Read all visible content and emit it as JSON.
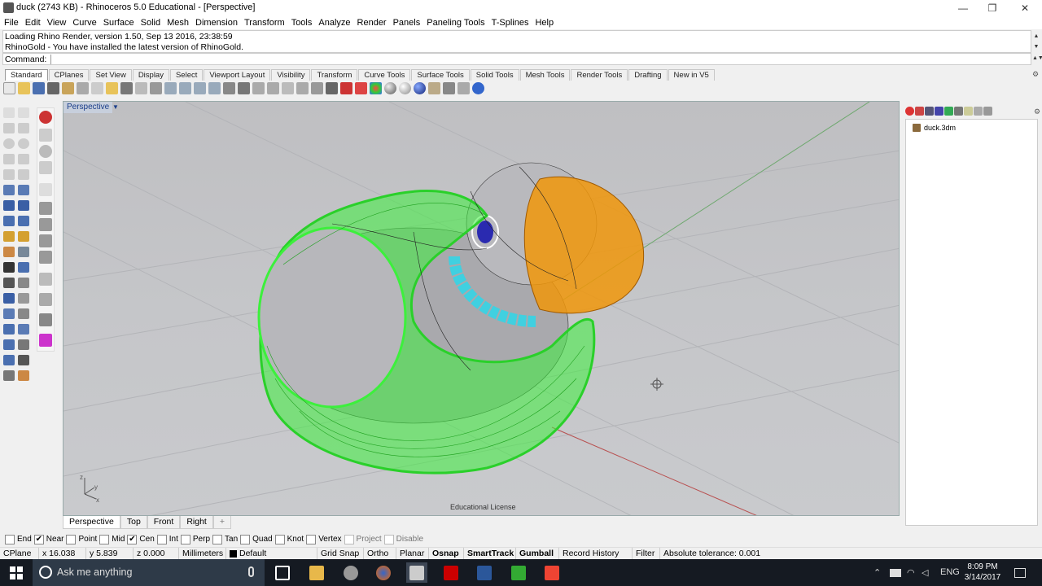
{
  "window": {
    "title": "duck (2743 KB) - Rhinoceros 5.0 Educational - [Perspective]",
    "minimize": "—",
    "maximize": "❐",
    "close": "✕"
  },
  "menu": [
    "File",
    "Edit",
    "View",
    "Curve",
    "Surface",
    "Solid",
    "Mesh",
    "Dimension",
    "Transform",
    "Tools",
    "Analyze",
    "Render",
    "Panels",
    "Paneling Tools",
    "T-Splines",
    "Help"
  ],
  "command_history": [
    "Loading Rhino Render, version 1.50, Sep 13 2016, 23:38:59",
    "RhinoGold - You have installed the latest version of RhinoGold."
  ],
  "command": {
    "label": "Command:",
    "value": ""
  },
  "toolbar_tabs": [
    "Standard",
    "CPlanes",
    "Set View",
    "Display",
    "Select",
    "Viewport Layout",
    "Visibility",
    "Transform",
    "Curve Tools",
    "Surface Tools",
    "Solid Tools",
    "Mesh Tools",
    "Render Tools",
    "Drafting",
    "New in V5"
  ],
  "viewport": {
    "name": "Perspective",
    "menu_arrow": "▼",
    "license": "Educational License",
    "axis_x": "x",
    "axis_y": "y",
    "axis_z": "z"
  },
  "viewport_tabs": [
    "Perspective",
    "Top",
    "Front",
    "Right",
    "+"
  ],
  "layers_panel": {
    "file": "duck.3dm"
  },
  "osnaps": [
    {
      "label": "End",
      "checked": false
    },
    {
      "label": "Near",
      "checked": true
    },
    {
      "label": "Point",
      "checked": false
    },
    {
      "label": "Mid",
      "checked": false
    },
    {
      "label": "Cen",
      "checked": true
    },
    {
      "label": "Int",
      "checked": false
    },
    {
      "label": "Perp",
      "checked": false
    },
    {
      "label": "Tan",
      "checked": false
    },
    {
      "label": "Quad",
      "checked": false
    },
    {
      "label": "Knot",
      "checked": false
    },
    {
      "label": "Vertex",
      "checked": false
    },
    {
      "label": "Project",
      "checked": false,
      "disabled": true
    },
    {
      "label": "Disable",
      "checked": false,
      "disabled": true
    }
  ],
  "status": {
    "cplane": "CPlane",
    "x": "x 16.038",
    "y": "y 5.839",
    "z": "z 0.000",
    "units": "Millimeters",
    "layer": "Default",
    "grid_snap": "Grid Snap",
    "ortho": "Ortho",
    "planar": "Planar",
    "osnap": "Osnap",
    "smarttrack": "SmartTrack",
    "gumball": "Gumball",
    "record_history": "Record History",
    "filter": "Filter",
    "tolerance": "Absolute tolerance: 0.001"
  },
  "taskbar": {
    "search_placeholder": "Ask me anything",
    "language": "ENG",
    "time": "8:09 PM",
    "date": "3/14/2017"
  },
  "colors": {
    "accent_green": "#3cf03c",
    "orange_beak": "#f0960a",
    "cyan": "#40d0e0",
    "taskbar": "#151a22"
  }
}
